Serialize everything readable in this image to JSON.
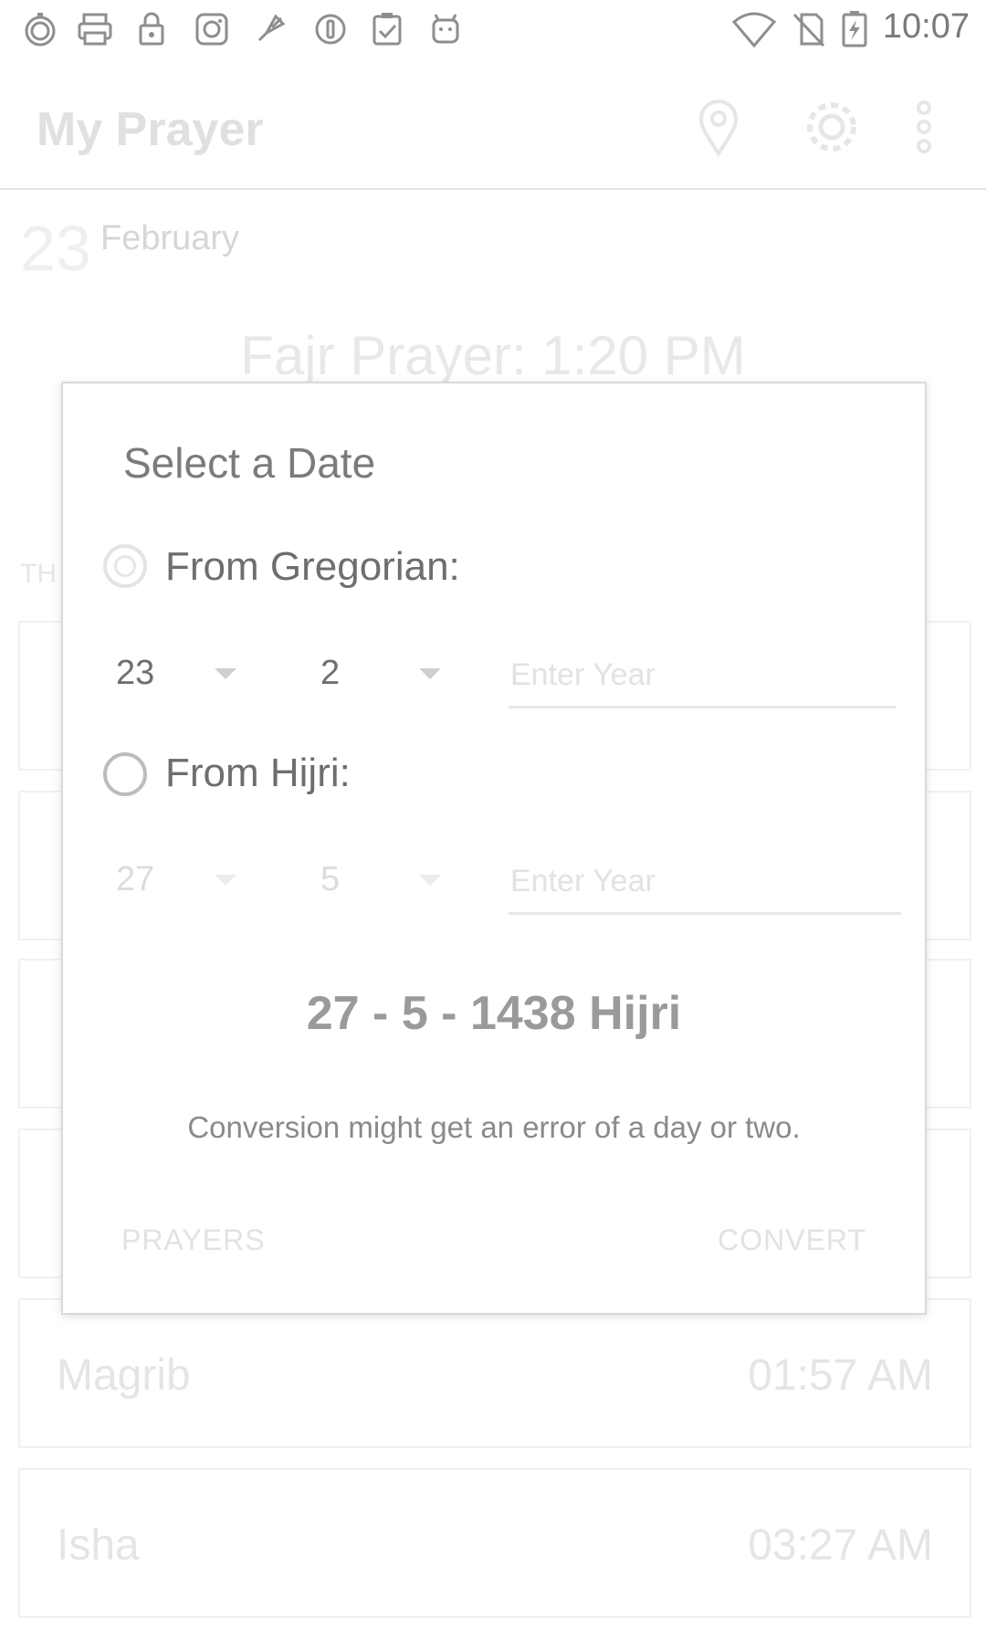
{
  "status_bar": {
    "time": "10:07",
    "left_icons": [
      "stopwatch-icon",
      "printer-icon",
      "lock-icon",
      "instagram-icon",
      "rocket-icon",
      "circle-info-icon",
      "clipboard-check-icon",
      "android-icon"
    ],
    "right_icons": [
      "wifi-icon",
      "no-sim-icon",
      "battery-charging-icon"
    ]
  },
  "app_bar": {
    "title": "My Prayer",
    "actions": [
      "location-pin-icon",
      "gear-icon",
      "more-vert-icon"
    ]
  },
  "background": {
    "date_day": "23",
    "date_month": "February",
    "next_prayer": "Fajr Prayer: 1:20 PM",
    "section_label": "TH",
    "prayers": [
      {
        "name": "Magrib",
        "time": "01:57 AM"
      },
      {
        "name": "Isha",
        "time": "03:27 AM"
      }
    ]
  },
  "dialog": {
    "title": "Select a Date",
    "gregorian": {
      "label": "From Gregorian:",
      "day": "23",
      "month": "2",
      "year_placeholder": "Enter Year"
    },
    "hijri": {
      "label": "From Hijri:",
      "day": "27",
      "month": "5",
      "year_placeholder": "Enter Year"
    },
    "result": "27 - 5 - 1438 Hijri",
    "note": "Conversion might get an error of a day or two.",
    "buttons": {
      "left": "PRAYERS",
      "right": "CONVERT"
    }
  }
}
